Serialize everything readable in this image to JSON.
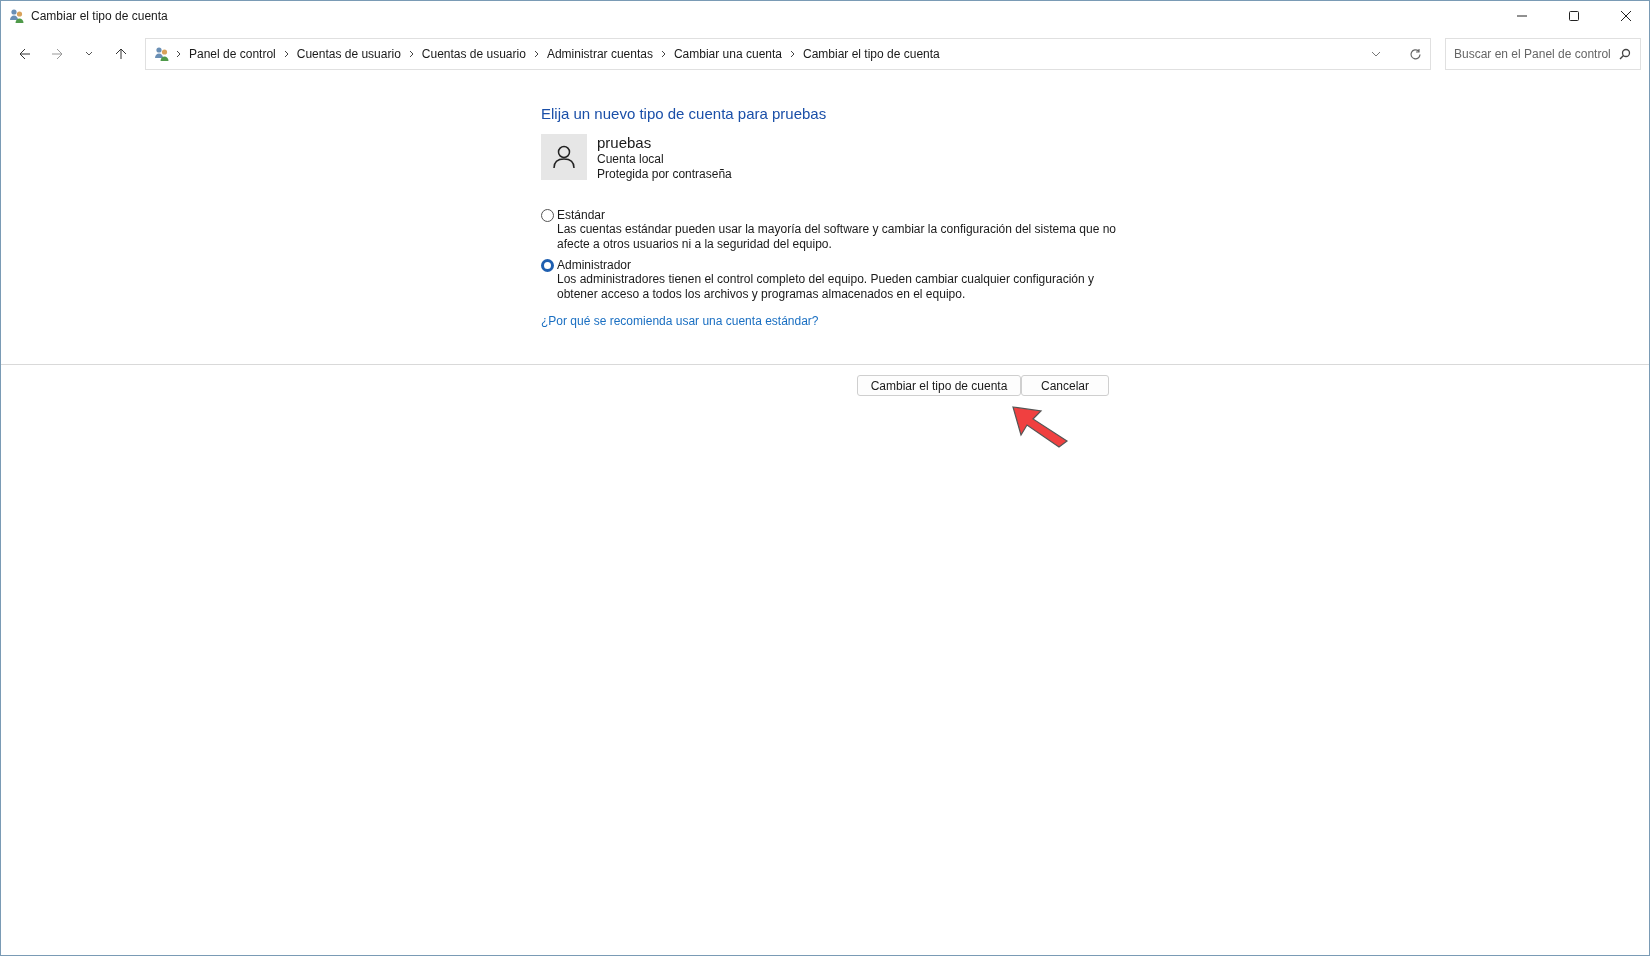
{
  "window": {
    "title": "Cambiar el tipo de cuenta"
  },
  "breadcrumb": [
    "Panel de control",
    "Cuentas de usuario",
    "Cuentas de usuario",
    "Administrar cuentas",
    "Cambiar una cuenta",
    "Cambiar el tipo de cuenta"
  ],
  "search": {
    "placeholder": "Buscar en el Panel de control"
  },
  "heading": "Elija un nuevo tipo de cuenta para pruebas",
  "account": {
    "name": "pruebas",
    "type": "Cuenta local",
    "protection": "Protegida por contraseña"
  },
  "options": [
    {
      "label": "Estándar",
      "description": "Las cuentas estándar pueden usar la mayoría del software y cambiar la configuración del sistema que no afecte a otros usuarios ni a la seguridad del equipo.",
      "selected": false
    },
    {
      "label": "Administrador",
      "description": "Los administradores tienen el control completo del equipo. Pueden cambiar cualquier configuración y obtener acceso a todos los archivos y programas almacenados en el equipo.",
      "selected": true
    }
  ],
  "help_link": "¿Por qué se recomienda usar una cuenta estándar?",
  "buttons": [
    "Cambiar el tipo de cuenta",
    "Cancelar"
  ]
}
